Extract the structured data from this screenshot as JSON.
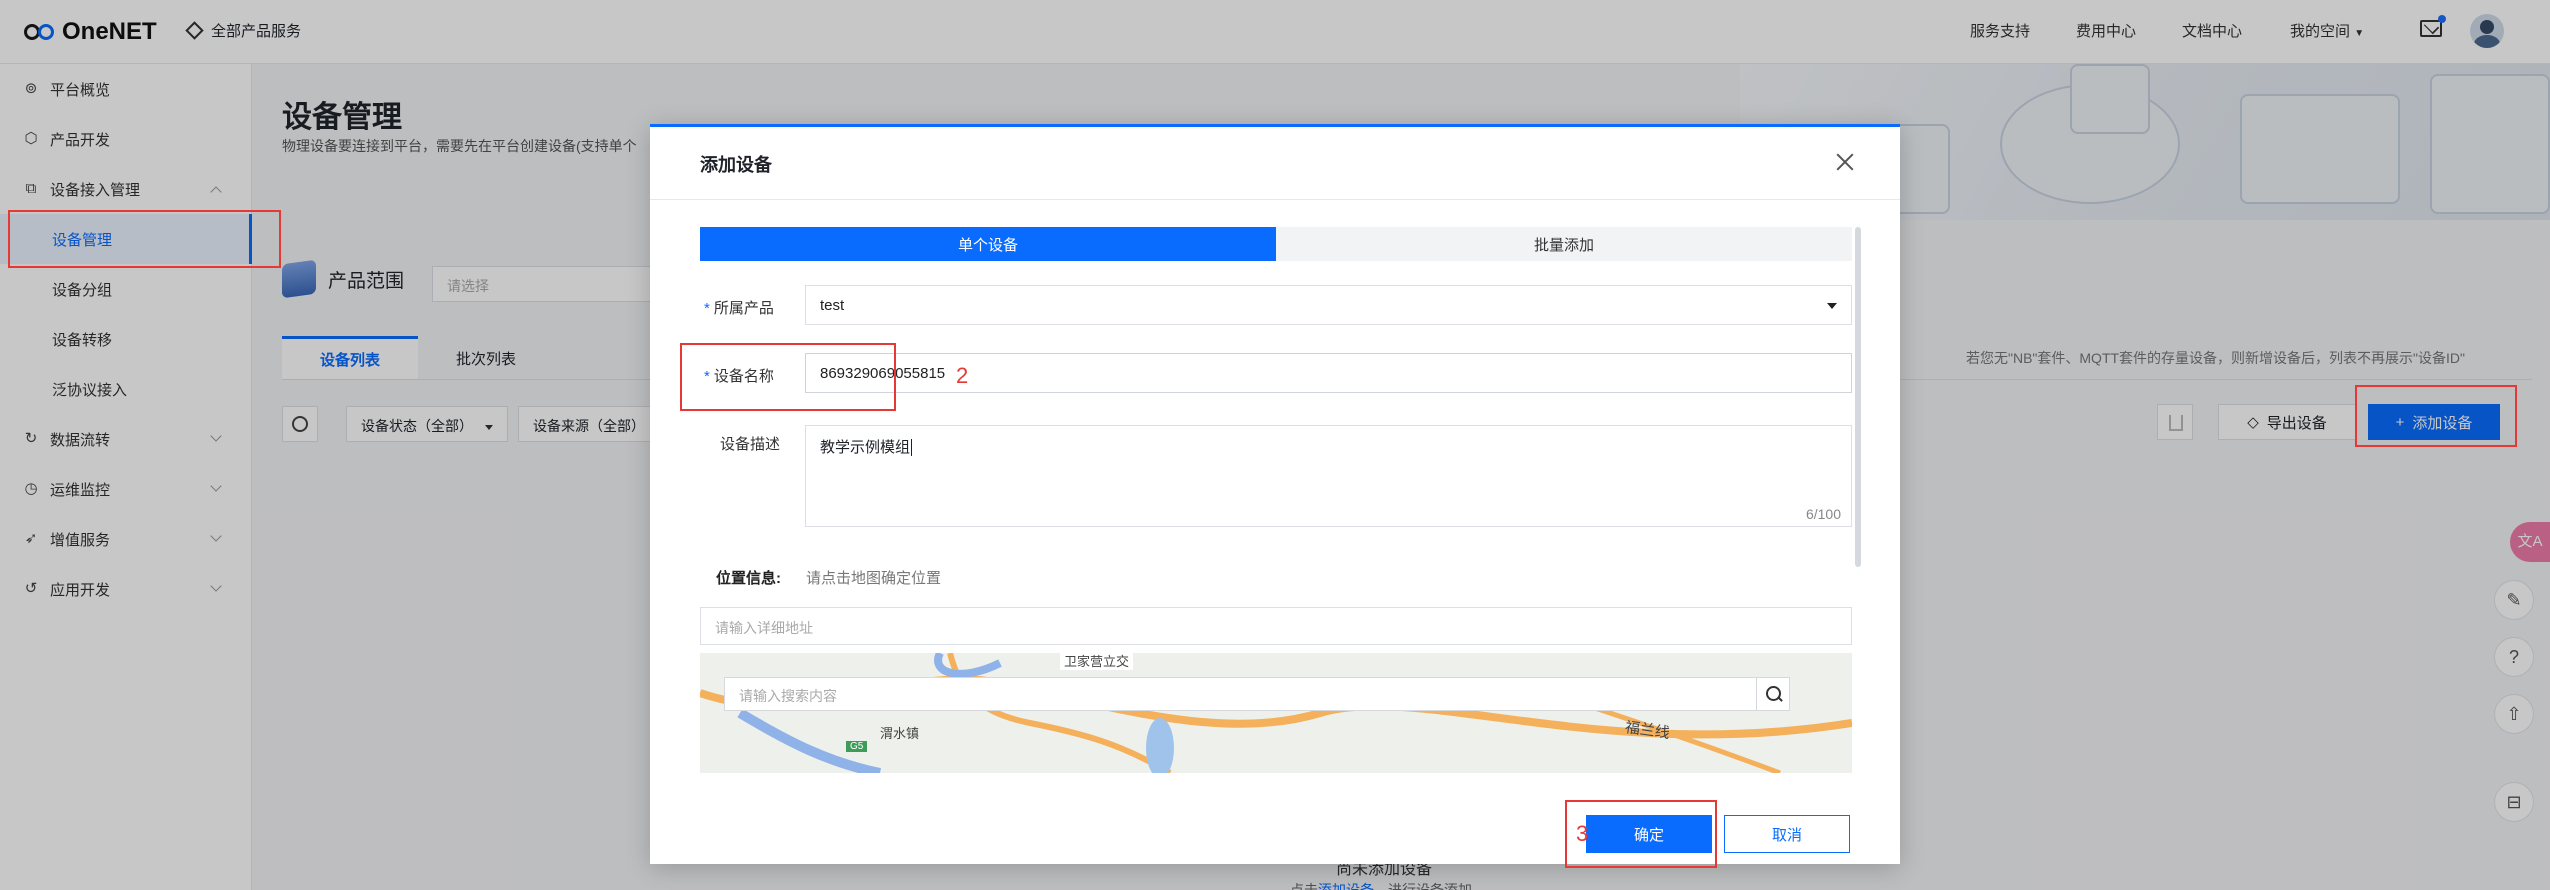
{
  "header": {
    "logo_text": "OneNET",
    "all_services": "全部产品服务",
    "nav": [
      "服务支持",
      "费用中心",
      "文档中心",
      "我的空间"
    ]
  },
  "sidebar": {
    "items": [
      {
        "label": "平台概览",
        "icon": "overview-icon"
      },
      {
        "label": "产品开发",
        "icon": "cube-icon"
      },
      {
        "label": "设备接入管理",
        "icon": "device-access-icon"
      },
      {
        "label": "设备管理"
      },
      {
        "label": "设备分组"
      },
      {
        "label": "设备转移"
      },
      {
        "label": "泛协议接入"
      },
      {
        "label": "数据流转",
        "icon": "dataflow-icon"
      },
      {
        "label": "运维监控",
        "icon": "monitor-icon"
      },
      {
        "label": "增值服务",
        "icon": "value-added-icon"
      },
      {
        "label": "应用开发",
        "icon": "app-dev-icon"
      }
    ]
  },
  "page": {
    "title": "设备管理",
    "description": "物理设备要连接到平台，需要先在平台创建设备(支持单个",
    "product_range_label": "产品范围",
    "product_select_placeholder": "请选择",
    "tabs": [
      "设备列表",
      "批次列表"
    ],
    "hint": "若您无\"NB\"套件、MQTT套件的存量设备，则新增设备后，列表不再展示\"设备ID\"",
    "filters": [
      "设备状态（全部）",
      "设备来源（全部）"
    ],
    "export_button": "导出设备",
    "add_button": "添加设备",
    "empty_title": "尚未添加设备",
    "empty_hint_prefix": "点击",
    "empty_hint_link": "添加设备",
    "empty_hint_suffix": "，进行设备添加"
  },
  "dialog": {
    "title": "添加设备",
    "tabs": [
      "单个设备",
      "批量添加"
    ],
    "product_label": "所属产品",
    "product_value": "test",
    "device_name_label": "设备名称",
    "device_name_value": "869329069055815",
    "desc_label": "设备描述",
    "desc_value": "教学示例模组",
    "desc_count": "6/100",
    "location_label": "位置信息:",
    "location_hint": "请点击地图确定位置",
    "address_placeholder": "请输入详细地址",
    "map_search_placeholder": "请输入搜索内容",
    "map_labels": [
      "卫家营立交",
      "渭水镇",
      "G5",
      "福兰线"
    ],
    "ok_button": "确定",
    "cancel_button": "取消"
  },
  "annotations": {
    "n2": "2",
    "n3": "3"
  },
  "translate_badge": "文A",
  "colors": {
    "primary": "#0a6cff",
    "annotation_red": "#e53935"
  }
}
